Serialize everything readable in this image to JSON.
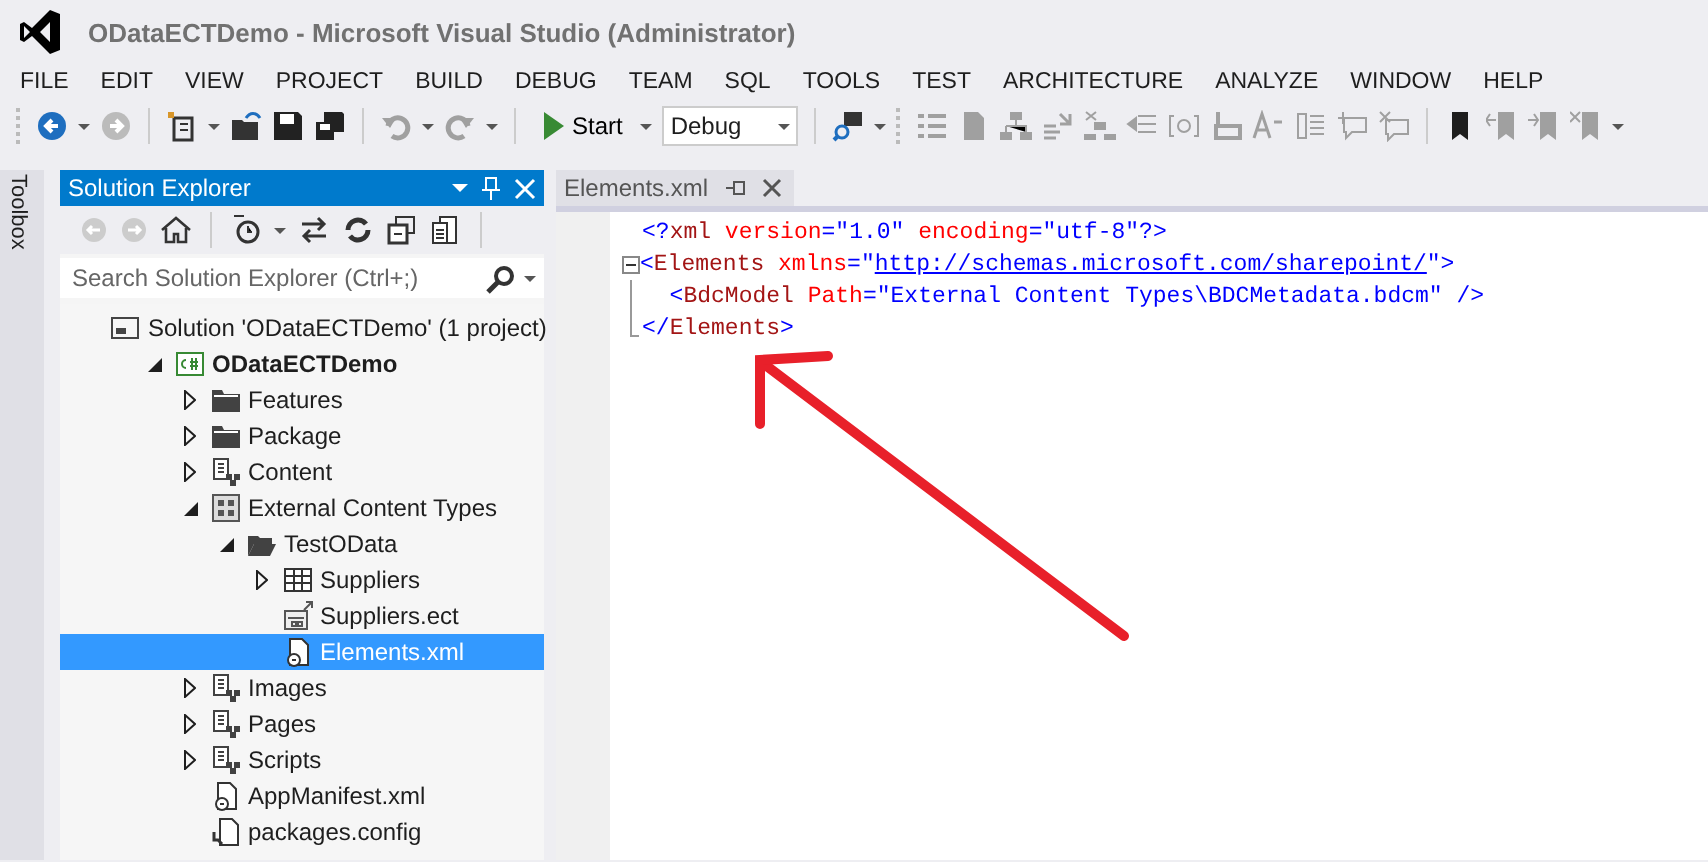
{
  "window": {
    "title": "ODataECTDemo - Microsoft Visual Studio (Administrator)"
  },
  "menu": [
    "FILE",
    "EDIT",
    "VIEW",
    "PROJECT",
    "BUILD",
    "DEBUG",
    "TEAM",
    "SQL",
    "TOOLS",
    "TEST",
    "ARCHITECTURE",
    "ANALYZE",
    "WINDOW",
    "HELP"
  ],
  "toolbar": {
    "start_label": "Start",
    "configuration": "Debug"
  },
  "toolbox_tab": "Toolbox",
  "solution_explorer": {
    "title": "Solution Explorer",
    "search": {
      "placeholder": "Search Solution Explorer (Ctrl+;)"
    },
    "tree": [
      {
        "label": "Solution 'ODataECTDemo' (1 project)",
        "kind": "solution",
        "selected": false,
        "children": [
          {
            "label": "ODataECTDemo",
            "kind": "csharp",
            "bold": true,
            "expanded": true,
            "selected": false,
            "children": [
              {
                "label": "Features",
                "kind": "folder",
                "expanded": false,
                "selected": false
              },
              {
                "label": "Package",
                "kind": "folder",
                "expanded": false,
                "selected": false
              },
              {
                "label": "Content",
                "kind": "module",
                "expanded": false,
                "selected": false
              },
              {
                "label": "External Content Types",
                "kind": "grid",
                "expanded": true,
                "selected": false,
                "children": [
                  {
                    "label": "TestOData",
                    "kind": "open-folder",
                    "expanded": true,
                    "selected": false,
                    "children": [
                      {
                        "label": "Suppliers",
                        "kind": "table",
                        "expanded": false,
                        "selected": false
                      },
                      {
                        "label": "Suppliers.ect",
                        "kind": "ect",
                        "selected": false
                      },
                      {
                        "label": "Elements.xml",
                        "kind": "xml",
                        "selected": true
                      }
                    ]
                  }
                ]
              },
              {
                "label": "Images",
                "kind": "module",
                "expanded": false,
                "selected": false
              },
              {
                "label": "Pages",
                "kind": "module",
                "expanded": false,
                "selected": false
              },
              {
                "label": "Scripts",
                "kind": "module",
                "expanded": false,
                "selected": false
              },
              {
                "label": "AppManifest.xml",
                "kind": "xml",
                "selected": false
              },
              {
                "label": "packages.config",
                "kind": "config",
                "selected": false
              }
            ]
          }
        ]
      }
    ]
  },
  "editor": {
    "tab": "Elements.xml",
    "lines": [
      [
        {
          "kind": "delim",
          "text": "<?"
        },
        {
          "kind": "tag",
          "text": "xml"
        },
        {
          "kind": "attr",
          "text": " version"
        },
        {
          "kind": "delim",
          "text": "=\""
        },
        {
          "kind": "value",
          "text": "1.0"
        },
        {
          "kind": "delim",
          "text": "\""
        },
        {
          "kind": "attr",
          "text": " encoding"
        },
        {
          "kind": "delim",
          "text": "=\""
        },
        {
          "kind": "value",
          "text": "utf-8"
        },
        {
          "kind": "delim",
          "text": "\"?>"
        }
      ],
      [
        {
          "kind": "delim",
          "text": "<"
        },
        {
          "kind": "tag",
          "text": "Elements"
        },
        {
          "kind": "attr",
          "text": " xmlns"
        },
        {
          "kind": "delim",
          "text": "=\""
        },
        {
          "kind": "link",
          "text": "http://schemas.microsoft.com/sharepoint/"
        },
        {
          "kind": "delim",
          "text": "\">"
        }
      ],
      [
        {
          "kind": "delim",
          "text": "  <"
        },
        {
          "kind": "tag",
          "text": "BdcModel"
        },
        {
          "kind": "attr",
          "text": " Path"
        },
        {
          "kind": "delim",
          "text": "=\""
        },
        {
          "kind": "value",
          "text": "External Content Types\\BDCMetadata.bdcm"
        },
        {
          "kind": "delim",
          "text": "\" />"
        }
      ],
      [
        {
          "kind": "delim",
          "text": "</"
        },
        {
          "kind": "tag",
          "text": "Elements"
        },
        {
          "kind": "delim",
          "text": ">"
        }
      ]
    ]
  }
}
